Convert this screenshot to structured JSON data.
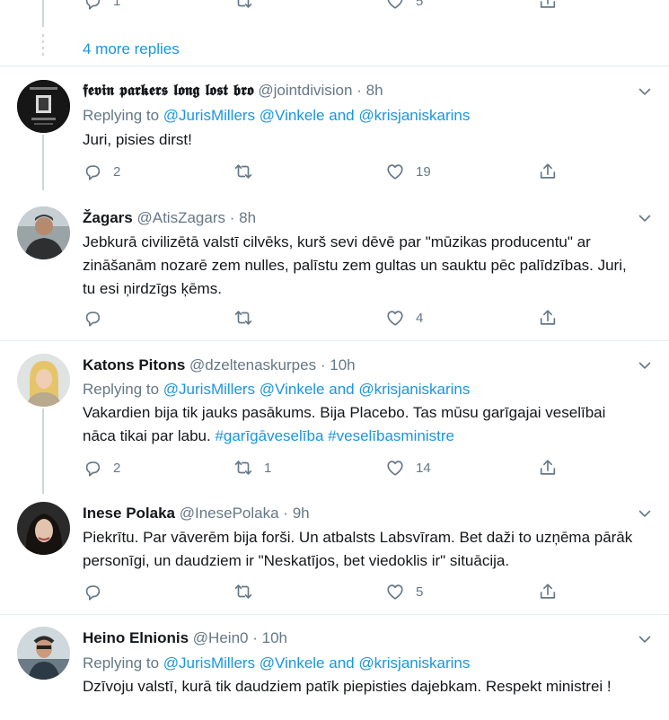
{
  "top": {
    "reply_count": "1",
    "like_count": "5",
    "more_replies": "4 more replies"
  },
  "tweets": [
    {
      "name": "𝖋𝖊𝖛𝖎𝖓 𝖕𝖆𝖗𝖐𝖊𝖗𝖘 𝖑𝖔𝖓𝖌 𝖑𝖔𝖘𝖙 𝖇𝖗𝖔",
      "handle": "@jointdivision",
      "time": "8h",
      "replying_prefix": "Replying to",
      "mention1": "@JurisMillers",
      "mention2": "@Vinkele",
      "and": "and",
      "mention3": "@krisjaniskarins",
      "text": "Juri, pisies dirst!",
      "replies": "2",
      "retweets": "",
      "likes": "19"
    },
    {
      "name": "Žagars",
      "handle": "@AtisZagars",
      "time": "8h",
      "text": "Jebkurā civilizētā valstī cilvēks, kurš sevi dēvē par \"mūzikas producentu\" ar zināšanām nozarē zem nulles, palīstu zem gultas un sauktu pēc palīdzības. Juri, tu esi ņirdzīgs ķēms.",
      "replies": "",
      "retweets": "",
      "likes": "4"
    },
    {
      "name": "Katons Pitons",
      "handle": "@dzeltenaskurpes",
      "time": "10h",
      "replying_prefix": "Replying to",
      "mention1": "@JurisMillers",
      "mention2": "@Vinkele",
      "and": "and",
      "mention3": "@krisjaniskarins",
      "text": "Vakardien bija tik jauks pasākums. Bija Placebo. Tas mūsu garīgajai veselībai nāca tikai par labu.",
      "hashtag1": "#garīgāveselība",
      "hashtag2": "#veselībasministre",
      "replies": "2",
      "retweets": "1",
      "likes": "14"
    },
    {
      "name": "Inese Polaka",
      "handle": "@InesePolaka",
      "time": "9h",
      "text": "Piekrītu. Par vāverēm bija forši. Un atbalsts Labsvīram. Bet daži to uzņēma pārāk personīgi, un daudziem ir \"Neskatījos, bet viedoklis ir\" situācija.",
      "replies": "",
      "retweets": "",
      "likes": "5"
    },
    {
      "name": "Heino Elnionis",
      "handle": "@Hein0",
      "time": "10h",
      "replying_prefix": "Replying to",
      "mention1": "@JurisMillers",
      "mention2": "@Vinkele",
      "and": "and",
      "mention3": "@krisjaniskarins",
      "text": "Dzīvoju valstī, kurā tik daudziem patīk piepisties dajebkam. Respekt ministrei !"
    }
  ],
  "dot_separator": "·",
  "icons": {
    "reply": "reply-icon",
    "retweet": "retweet-icon",
    "like": "like-icon",
    "share": "share-icon",
    "chevron": "chevron-down-icon"
  },
  "colors": {
    "link": "#1b95e0",
    "secondary": "#657786",
    "border": "#e6ecf0"
  }
}
